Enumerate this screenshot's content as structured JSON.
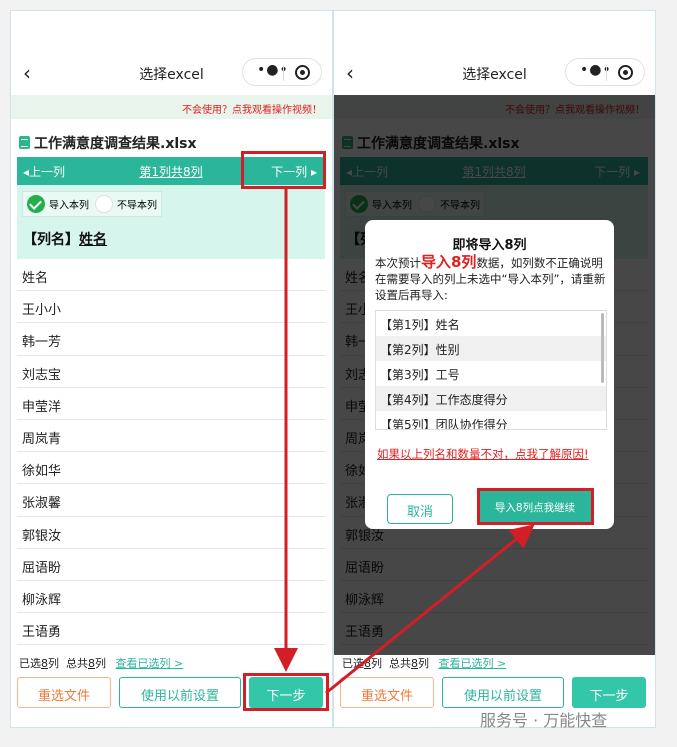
{
  "wechat": {
    "title": "选择excel",
    "back_icon": "chevron-left-icon",
    "menu_icon": "more-dots-icon",
    "record_icon": "record-icon"
  },
  "help_link": "不会使用？点我观看操作视频！",
  "file": {
    "name": "工作满意度调查结果.xlsx",
    "icon": "excel-file-icon"
  },
  "col_nav": {
    "prev": "上一列",
    "current": "第1列共8列",
    "next": "下一列"
  },
  "options": {
    "import": "导入本列",
    "skip": "不导本列"
  },
  "column_name": {
    "label": "【列名】",
    "value": "姓名"
  },
  "rows": [
    "姓名",
    "王小小",
    "韩一芳",
    "刘志宝",
    "申莹洋",
    "周岚青",
    "徐如华",
    "张淑馨",
    "郭银汝",
    "屈语盼",
    "柳泳辉",
    "王语勇"
  ],
  "footer": {
    "selected_prefix": "已选",
    "selected_count": "8",
    "col_unit": "列",
    "total_prefix": "总共",
    "total_count": "8",
    "view_selected": "查看已选列 >"
  },
  "buttons": {
    "reselect": "重选文件",
    "use_previous": "使用以前设置",
    "next_step": "下一步"
  },
  "modal": {
    "title": "即将导入8列",
    "desc_pre": "本次预计",
    "desc_highlight": "导入8列",
    "desc_post": "数据，如列数不正确说明在需要导入的列上未选中“导入本列”，请重新设置后再导入:",
    "columns": [
      "【第1列】姓名",
      "【第2列】性别",
      "【第3列】工号",
      "【第4列】工作态度得分",
      "【第5列】团队协作得分"
    ],
    "reason_link": "如果以上列名和数量不对，点我了解原因!",
    "cancel": "取消",
    "continue": "导入8列点我继续"
  },
  "watermark": "服务号 · 万能快查",
  "colors": {
    "primary": "#2bb59a",
    "annotation_red": "#d21e26",
    "link_red": "#e02020",
    "orange": "#f07a3a"
  }
}
